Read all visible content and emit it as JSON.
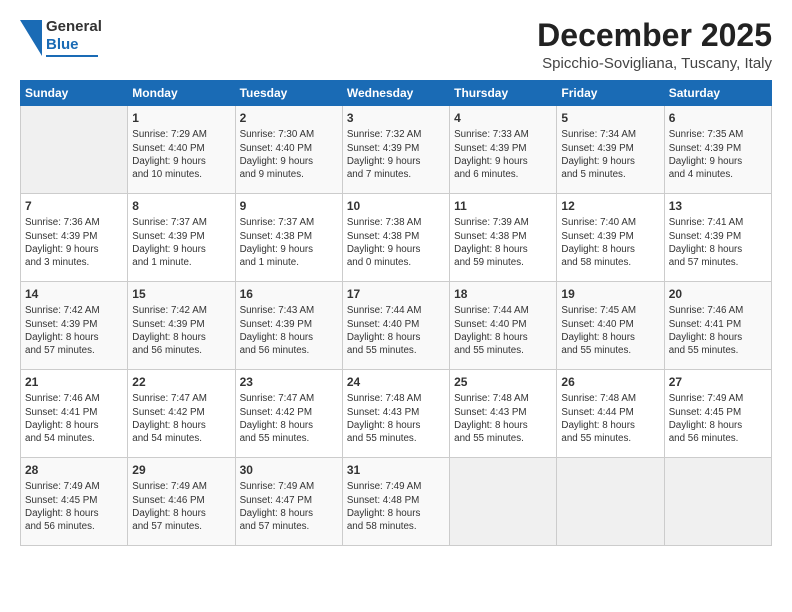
{
  "logo": {
    "general": "General",
    "blue": "Blue"
  },
  "title": "December 2025",
  "location": "Spicchio-Sovigliana, Tuscany, Italy",
  "weekdays": [
    "Sunday",
    "Monday",
    "Tuesday",
    "Wednesday",
    "Thursday",
    "Friday",
    "Saturday"
  ],
  "weeks": [
    [
      {
        "day": "",
        "detail": ""
      },
      {
        "day": "1",
        "detail": "Sunrise: 7:29 AM\nSunset: 4:40 PM\nDaylight: 9 hours\nand 10 minutes."
      },
      {
        "day": "2",
        "detail": "Sunrise: 7:30 AM\nSunset: 4:40 PM\nDaylight: 9 hours\nand 9 minutes."
      },
      {
        "day": "3",
        "detail": "Sunrise: 7:32 AM\nSunset: 4:39 PM\nDaylight: 9 hours\nand 7 minutes."
      },
      {
        "day": "4",
        "detail": "Sunrise: 7:33 AM\nSunset: 4:39 PM\nDaylight: 9 hours\nand 6 minutes."
      },
      {
        "day": "5",
        "detail": "Sunrise: 7:34 AM\nSunset: 4:39 PM\nDaylight: 9 hours\nand 5 minutes."
      },
      {
        "day": "6",
        "detail": "Sunrise: 7:35 AM\nSunset: 4:39 PM\nDaylight: 9 hours\nand 4 minutes."
      }
    ],
    [
      {
        "day": "7",
        "detail": "Sunrise: 7:36 AM\nSunset: 4:39 PM\nDaylight: 9 hours\nand 3 minutes."
      },
      {
        "day": "8",
        "detail": "Sunrise: 7:37 AM\nSunset: 4:39 PM\nDaylight: 9 hours\nand 1 minute."
      },
      {
        "day": "9",
        "detail": "Sunrise: 7:37 AM\nSunset: 4:38 PM\nDaylight: 9 hours\nand 1 minute."
      },
      {
        "day": "10",
        "detail": "Sunrise: 7:38 AM\nSunset: 4:38 PM\nDaylight: 9 hours\nand 0 minutes."
      },
      {
        "day": "11",
        "detail": "Sunrise: 7:39 AM\nSunset: 4:38 PM\nDaylight: 8 hours\nand 59 minutes."
      },
      {
        "day": "12",
        "detail": "Sunrise: 7:40 AM\nSunset: 4:39 PM\nDaylight: 8 hours\nand 58 minutes."
      },
      {
        "day": "13",
        "detail": "Sunrise: 7:41 AM\nSunset: 4:39 PM\nDaylight: 8 hours\nand 57 minutes."
      }
    ],
    [
      {
        "day": "14",
        "detail": "Sunrise: 7:42 AM\nSunset: 4:39 PM\nDaylight: 8 hours\nand 57 minutes."
      },
      {
        "day": "15",
        "detail": "Sunrise: 7:42 AM\nSunset: 4:39 PM\nDaylight: 8 hours\nand 56 minutes."
      },
      {
        "day": "16",
        "detail": "Sunrise: 7:43 AM\nSunset: 4:39 PM\nDaylight: 8 hours\nand 56 minutes."
      },
      {
        "day": "17",
        "detail": "Sunrise: 7:44 AM\nSunset: 4:40 PM\nDaylight: 8 hours\nand 55 minutes."
      },
      {
        "day": "18",
        "detail": "Sunrise: 7:44 AM\nSunset: 4:40 PM\nDaylight: 8 hours\nand 55 minutes."
      },
      {
        "day": "19",
        "detail": "Sunrise: 7:45 AM\nSunset: 4:40 PM\nDaylight: 8 hours\nand 55 minutes."
      },
      {
        "day": "20",
        "detail": "Sunrise: 7:46 AM\nSunset: 4:41 PM\nDaylight: 8 hours\nand 55 minutes."
      }
    ],
    [
      {
        "day": "21",
        "detail": "Sunrise: 7:46 AM\nSunset: 4:41 PM\nDaylight: 8 hours\nand 54 minutes."
      },
      {
        "day": "22",
        "detail": "Sunrise: 7:47 AM\nSunset: 4:42 PM\nDaylight: 8 hours\nand 54 minutes."
      },
      {
        "day": "23",
        "detail": "Sunrise: 7:47 AM\nSunset: 4:42 PM\nDaylight: 8 hours\nand 55 minutes."
      },
      {
        "day": "24",
        "detail": "Sunrise: 7:48 AM\nSunset: 4:43 PM\nDaylight: 8 hours\nand 55 minutes."
      },
      {
        "day": "25",
        "detail": "Sunrise: 7:48 AM\nSunset: 4:43 PM\nDaylight: 8 hours\nand 55 minutes."
      },
      {
        "day": "26",
        "detail": "Sunrise: 7:48 AM\nSunset: 4:44 PM\nDaylight: 8 hours\nand 55 minutes."
      },
      {
        "day": "27",
        "detail": "Sunrise: 7:49 AM\nSunset: 4:45 PM\nDaylight: 8 hours\nand 56 minutes."
      }
    ],
    [
      {
        "day": "28",
        "detail": "Sunrise: 7:49 AM\nSunset: 4:45 PM\nDaylight: 8 hours\nand 56 minutes."
      },
      {
        "day": "29",
        "detail": "Sunrise: 7:49 AM\nSunset: 4:46 PM\nDaylight: 8 hours\nand 57 minutes."
      },
      {
        "day": "30",
        "detail": "Sunrise: 7:49 AM\nSunset: 4:47 PM\nDaylight: 8 hours\nand 57 minutes."
      },
      {
        "day": "31",
        "detail": "Sunrise: 7:49 AM\nSunset: 4:48 PM\nDaylight: 8 hours\nand 58 minutes."
      },
      {
        "day": "",
        "detail": ""
      },
      {
        "day": "",
        "detail": ""
      },
      {
        "day": "",
        "detail": ""
      }
    ]
  ]
}
